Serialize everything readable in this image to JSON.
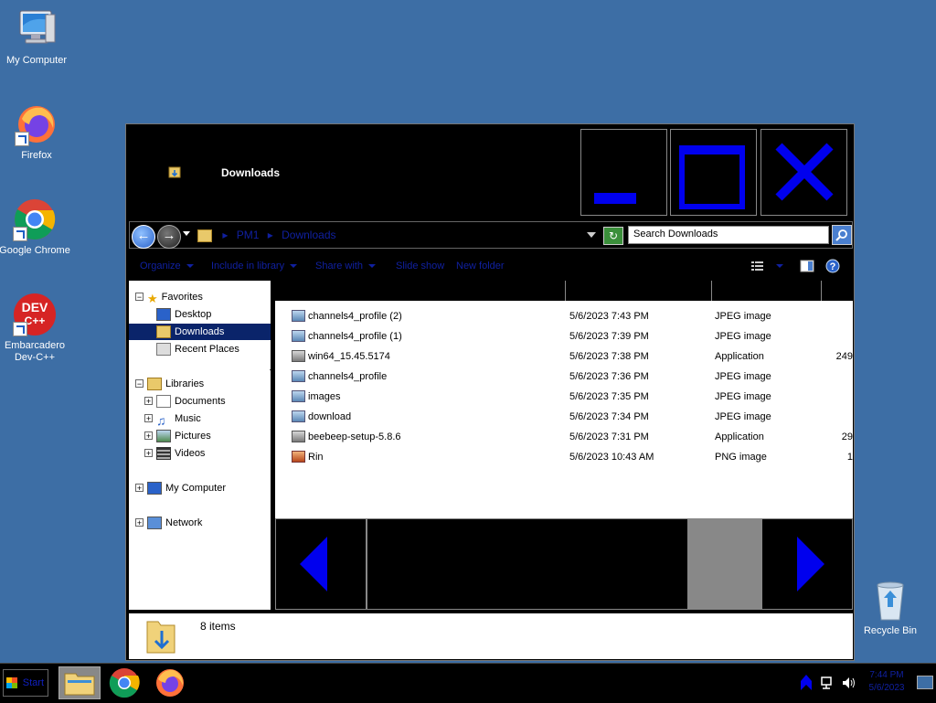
{
  "desktop": {
    "icons": [
      {
        "label": "My Computer"
      },
      {
        "label": "Firefox"
      },
      {
        "label": "Google Chrome"
      },
      {
        "label": "Embarcadero Dev-C++",
        "badge": "DEV C++"
      },
      {
        "label": "Recycle Bin"
      }
    ]
  },
  "window": {
    "title": "Downloads",
    "address": {
      "crumbs": [
        "PM1",
        "Downloads"
      ],
      "separator": "▸"
    },
    "search_placeholder": "Search Downloads",
    "toolbar": {
      "organize": "Organize",
      "include": "Include in library",
      "share": "Share with",
      "slideshow": "Slide show",
      "new_folder": "New folder"
    },
    "nav": {
      "favorites": "Favorites",
      "desktop": "Desktop",
      "downloads": "Downloads",
      "recent": "Recent Places",
      "libraries": "Libraries",
      "documents": "Documents",
      "music": "Music",
      "pictures": "Pictures",
      "videos": "Videos",
      "computer": "My Computer",
      "network": "Network"
    },
    "files": [
      {
        "name": "channels4_profile (2)",
        "date": "5/6/2023 7:43 PM",
        "type": "JPEG image",
        "size": "",
        "kind": "img"
      },
      {
        "name": "channels4_profile (1)",
        "date": "5/6/2023 7:39 PM",
        "type": "JPEG image",
        "size": "",
        "kind": "img"
      },
      {
        "name": "win64_15.45.5174",
        "date": "5/6/2023 7:38 PM",
        "type": "Application",
        "size": "249",
        "kind": "app"
      },
      {
        "name": "channels4_profile",
        "date": "5/6/2023 7:36 PM",
        "type": "JPEG image",
        "size": "",
        "kind": "img"
      },
      {
        "name": "images",
        "date": "5/6/2023 7:35 PM",
        "type": "JPEG image",
        "size": "",
        "kind": "img"
      },
      {
        "name": "download",
        "date": "5/6/2023 7:34 PM",
        "type": "JPEG image",
        "size": "",
        "kind": "img"
      },
      {
        "name": "beebeep-setup-5.8.6",
        "date": "5/6/2023 7:31 PM",
        "type": "Application",
        "size": "29",
        "kind": "app"
      },
      {
        "name": "Rin",
        "date": "5/6/2023 10:43 AM",
        "type": "PNG image",
        "size": "1",
        "kind": "png"
      }
    ],
    "status": "8 items"
  },
  "taskbar": {
    "start": "Start",
    "clock_time": "7:44 PM",
    "clock_date": "5/6/2023"
  },
  "colors": {
    "desktop": "#3d6ea5",
    "accent_blue": "#0000ee",
    "selection": "#0a246a"
  }
}
